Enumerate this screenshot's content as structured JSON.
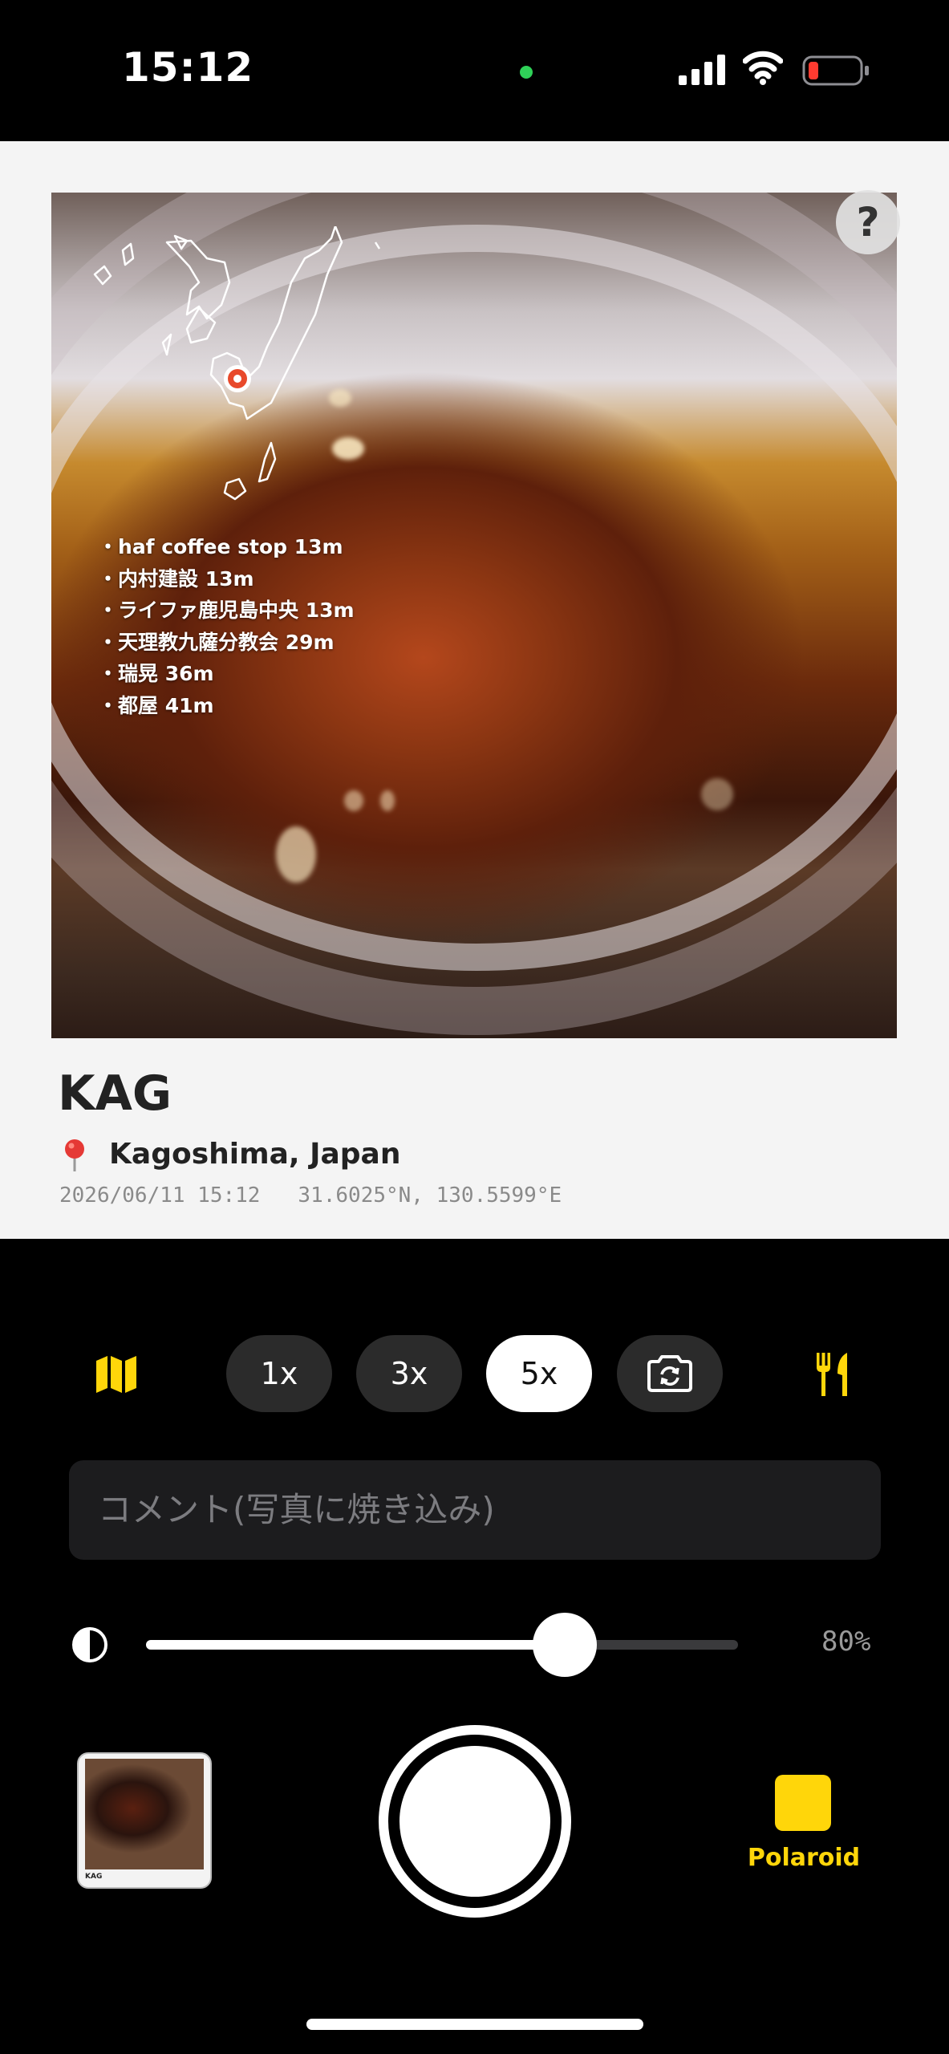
{
  "status_bar": {
    "time": "15:12"
  },
  "card": {
    "title": "KAG",
    "location": "Kagoshima, Japan",
    "date_time": "2026/06/11 15:12",
    "coordinates": "31.6025°N, 130.5599°E",
    "help_label": "?",
    "nearby_places": [
      "haf coffee stop 13m",
      "内村建設 13m",
      "ライファ鹿児島中央 13m",
      "天理教九薩分教会 29m",
      "瑞晃 36m",
      "都屋 41m"
    ]
  },
  "zoom": {
    "options": [
      "1x",
      "3x",
      "5x"
    ],
    "selected": "5x"
  },
  "comment": {
    "placeholder": "コメント(写真に焼き込み)"
  },
  "opacity": {
    "value_label": "80%",
    "value": 0.8
  },
  "film": {
    "label": "Polaroid",
    "color": "#ffd60a"
  },
  "thumbnail": {
    "caption": "KAG"
  },
  "icons": [
    "map-icon",
    "flip-camera-icon",
    "utensils-icon",
    "contrast-icon",
    "pin-icon",
    "help-icon"
  ]
}
